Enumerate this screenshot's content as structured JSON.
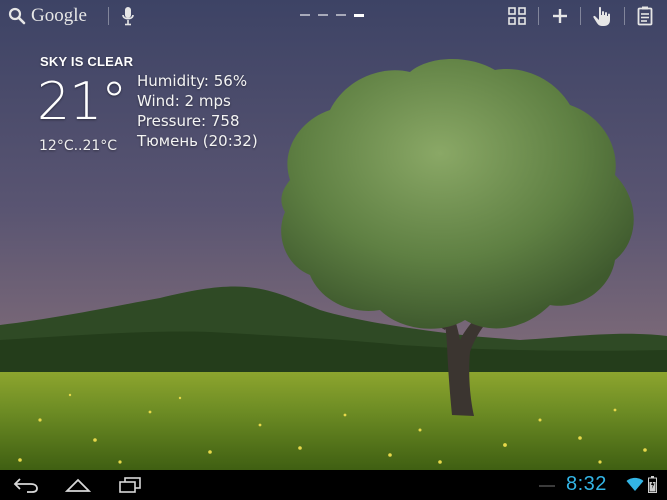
{
  "top_bar": {
    "search_label": "Google",
    "page_count": 4,
    "active_page": 4
  },
  "weather": {
    "condition": "SKY IS CLEAR",
    "temperature": "21°",
    "range": "12°C..21°C",
    "humidity": "Humidity: 56%",
    "wind": "Wind: 2 mps",
    "pressure": "Pressure: 758",
    "location_time": "Тюмень (20:32)"
  },
  "system_bar": {
    "clock": "8:32"
  },
  "colors": {
    "clock_accent": "#33b5e5",
    "sky_top": "#3e4466",
    "sky_bottom": "#7a6876",
    "grass": "#6f8f22"
  },
  "icons": {
    "search": "search-icon",
    "voice": "microphone-icon",
    "apps": "apps-grid-icon",
    "add": "plus-icon",
    "touch": "touch-hand-icon",
    "notes": "notes-icon",
    "back": "back-icon",
    "home": "home-icon",
    "recents": "recent-apps-icon",
    "wifi": "wifi-icon",
    "battery": "battery-icon"
  }
}
